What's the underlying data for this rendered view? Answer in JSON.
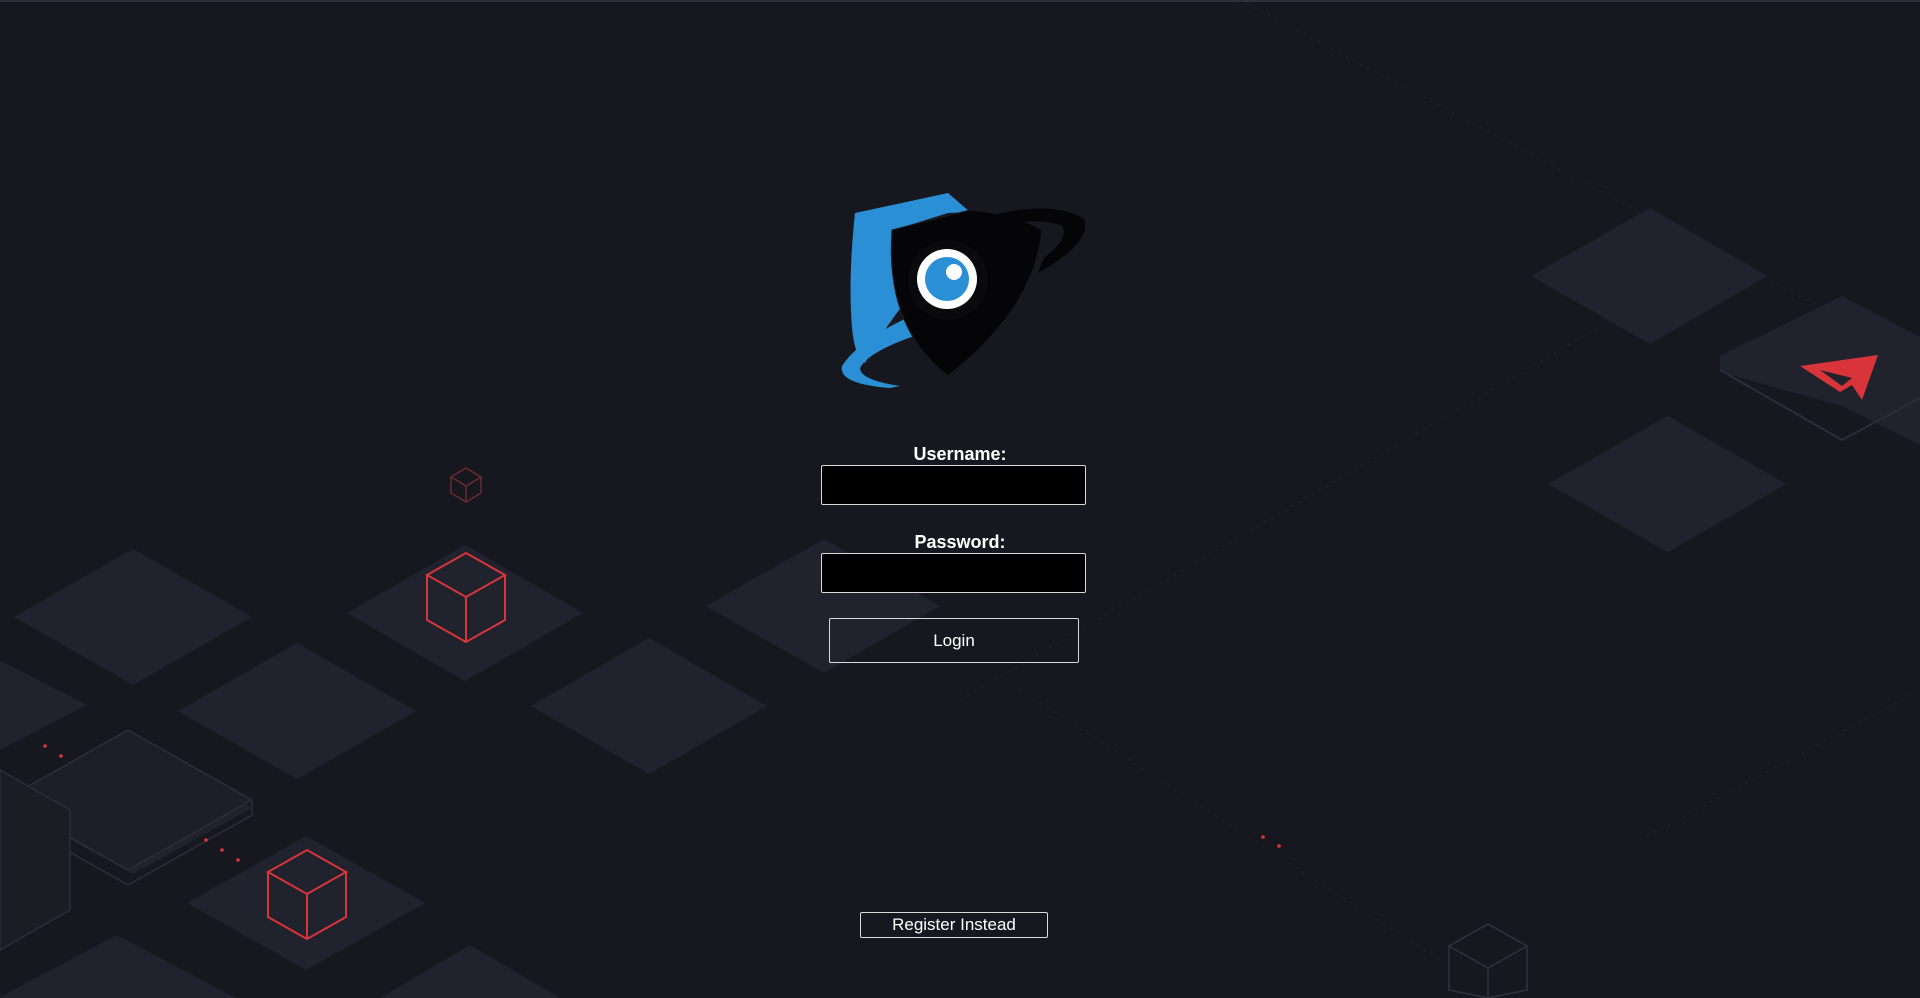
{
  "form": {
    "username_label": "Username:",
    "username_value": "",
    "password_label": "Password:",
    "password_value": "",
    "login_label": "Login",
    "register_label": "Register Instead"
  },
  "icons": {
    "logo": "shield-eye-logo",
    "background": "isometric-tiles-and-cubes",
    "corner_logo": "red-arrow-logo"
  },
  "colors": {
    "background": "#17181f",
    "tile": "#20222d",
    "accent_red": "#d8343a",
    "logo_blue": "#2a8fd4",
    "input_bg": "#000000",
    "text": "#ffffff"
  }
}
